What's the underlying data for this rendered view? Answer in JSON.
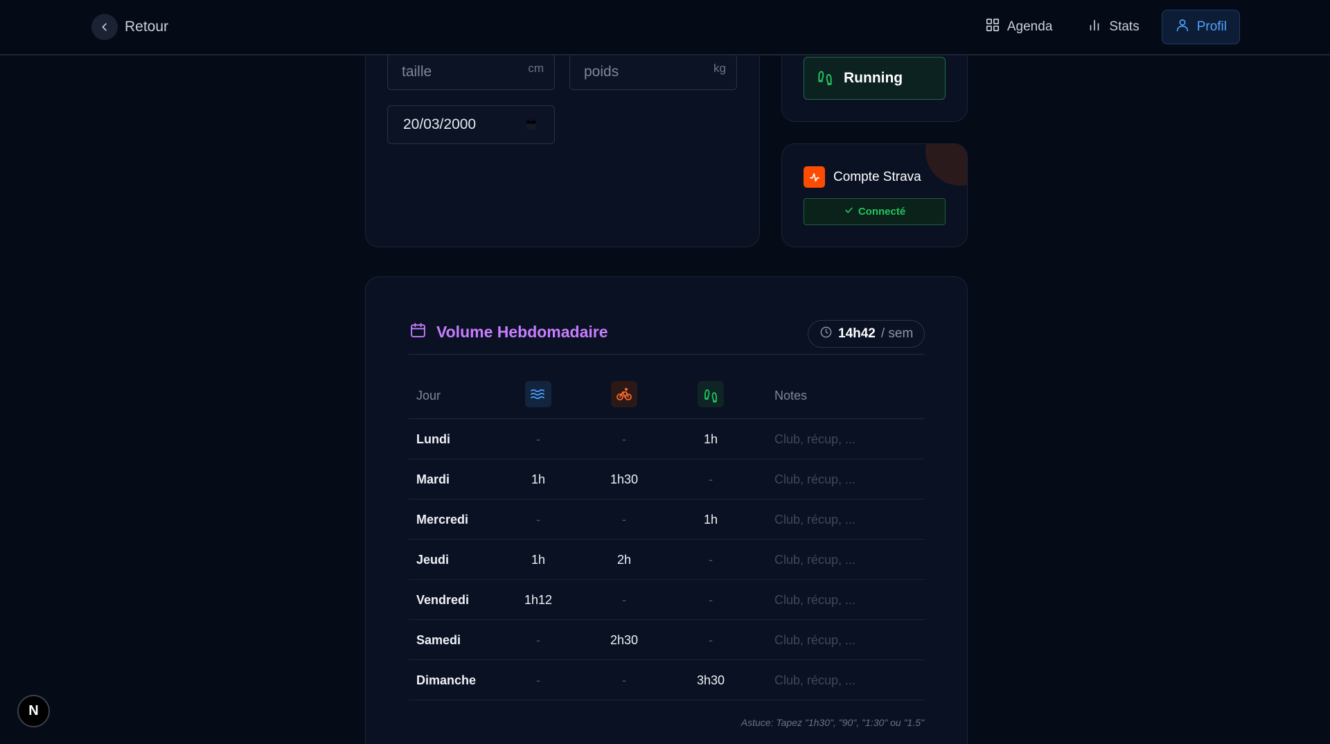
{
  "nav": {
    "back_label": "Retour",
    "links": [
      {
        "label": "Agenda",
        "icon": "grid-icon",
        "active": false
      },
      {
        "label": "Stats",
        "icon": "bar-chart-icon",
        "active": false
      },
      {
        "label": "Profil",
        "icon": "user-icon",
        "active": true
      }
    ]
  },
  "profile": {
    "taille_placeholder": "taille",
    "taille_unit": "cm",
    "poids_placeholder": "poids",
    "poids_unit": "kg",
    "birthdate": "20/03/2000"
  },
  "sport": {
    "label": "Running",
    "icon": "footprints-icon"
  },
  "strava": {
    "title": "Compte Strava",
    "status": "Connecté"
  },
  "volume": {
    "title": "Volume Hebdomadaire",
    "total": "14h42",
    "total_unit": "/ sem",
    "columns": {
      "day": "Jour",
      "notes": "Notes"
    },
    "sport_icons": [
      "waves-icon",
      "bike-icon",
      "footprints-icon"
    ],
    "notes_placeholder": "Club, récup, ...",
    "rows": [
      {
        "day": "Lundi",
        "swim": "-",
        "bike": "-",
        "run": "1h"
      },
      {
        "day": "Mardi",
        "swim": "1h",
        "bike": "1h30",
        "run": "-"
      },
      {
        "day": "Mercredi",
        "swim": "-",
        "bike": "-",
        "run": "1h"
      },
      {
        "day": "Jeudi",
        "swim": "1h",
        "bike": "2h",
        "run": "-"
      },
      {
        "day": "Vendredi",
        "swim": "1h12",
        "bike": "-",
        "run": "-"
      },
      {
        "day": "Samedi",
        "swim": "-",
        "bike": "2h30",
        "run": "-"
      },
      {
        "day": "Dimanche",
        "swim": "-",
        "bike": "-",
        "run": "3h30"
      }
    ],
    "tip": "Astuce: Tapez \"1h30\", \"90\", \"1:30\" ou \"1.5\""
  },
  "colors": {
    "accent": "#4fa3ff",
    "purple": "#c77dff",
    "green": "#22c55e",
    "strava": "#fc4c02"
  }
}
